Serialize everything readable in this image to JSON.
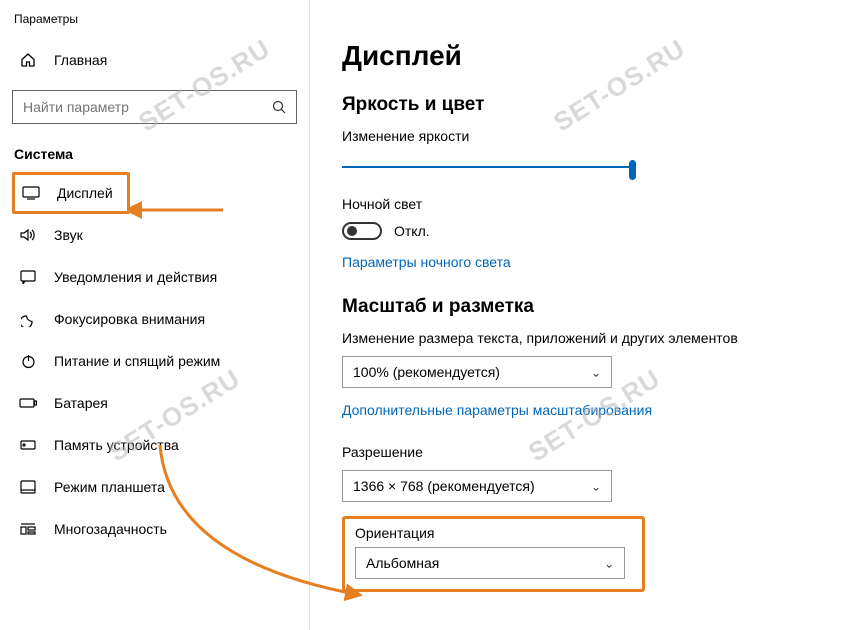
{
  "window": {
    "title": "Параметры"
  },
  "sidebar": {
    "home": "Главная",
    "search_placeholder": "Найти параметр",
    "section": "Система",
    "items": [
      {
        "label": "Дисплей"
      },
      {
        "label": "Звук"
      },
      {
        "label": "Уведомления и действия"
      },
      {
        "label": "Фокусировка внимания"
      },
      {
        "label": "Питание и спящий режим"
      },
      {
        "label": "Батарея"
      },
      {
        "label": "Память устройства"
      },
      {
        "label": "Режим планшета"
      },
      {
        "label": "Многозадачность"
      }
    ]
  },
  "main": {
    "h1": "Дисплей",
    "brightness_section": "Яркость и цвет",
    "brightness_label": "Изменение яркости",
    "night_light_label": "Ночной свет",
    "night_light_state": "Откл.",
    "night_light_link": "Параметры ночного света",
    "scale_section": "Масштаб и разметка",
    "scale_label": "Изменение размера текста, приложений и других элементов",
    "scale_value": "100% (рекомендуется)",
    "scale_link": "Дополнительные параметры масштабирования",
    "resolution_label": "Разрешение",
    "resolution_value": "1366 × 768 (рекомендуется)",
    "orientation_label": "Ориентация",
    "orientation_value": "Альбомная"
  },
  "watermark": "SET-OS.RU"
}
